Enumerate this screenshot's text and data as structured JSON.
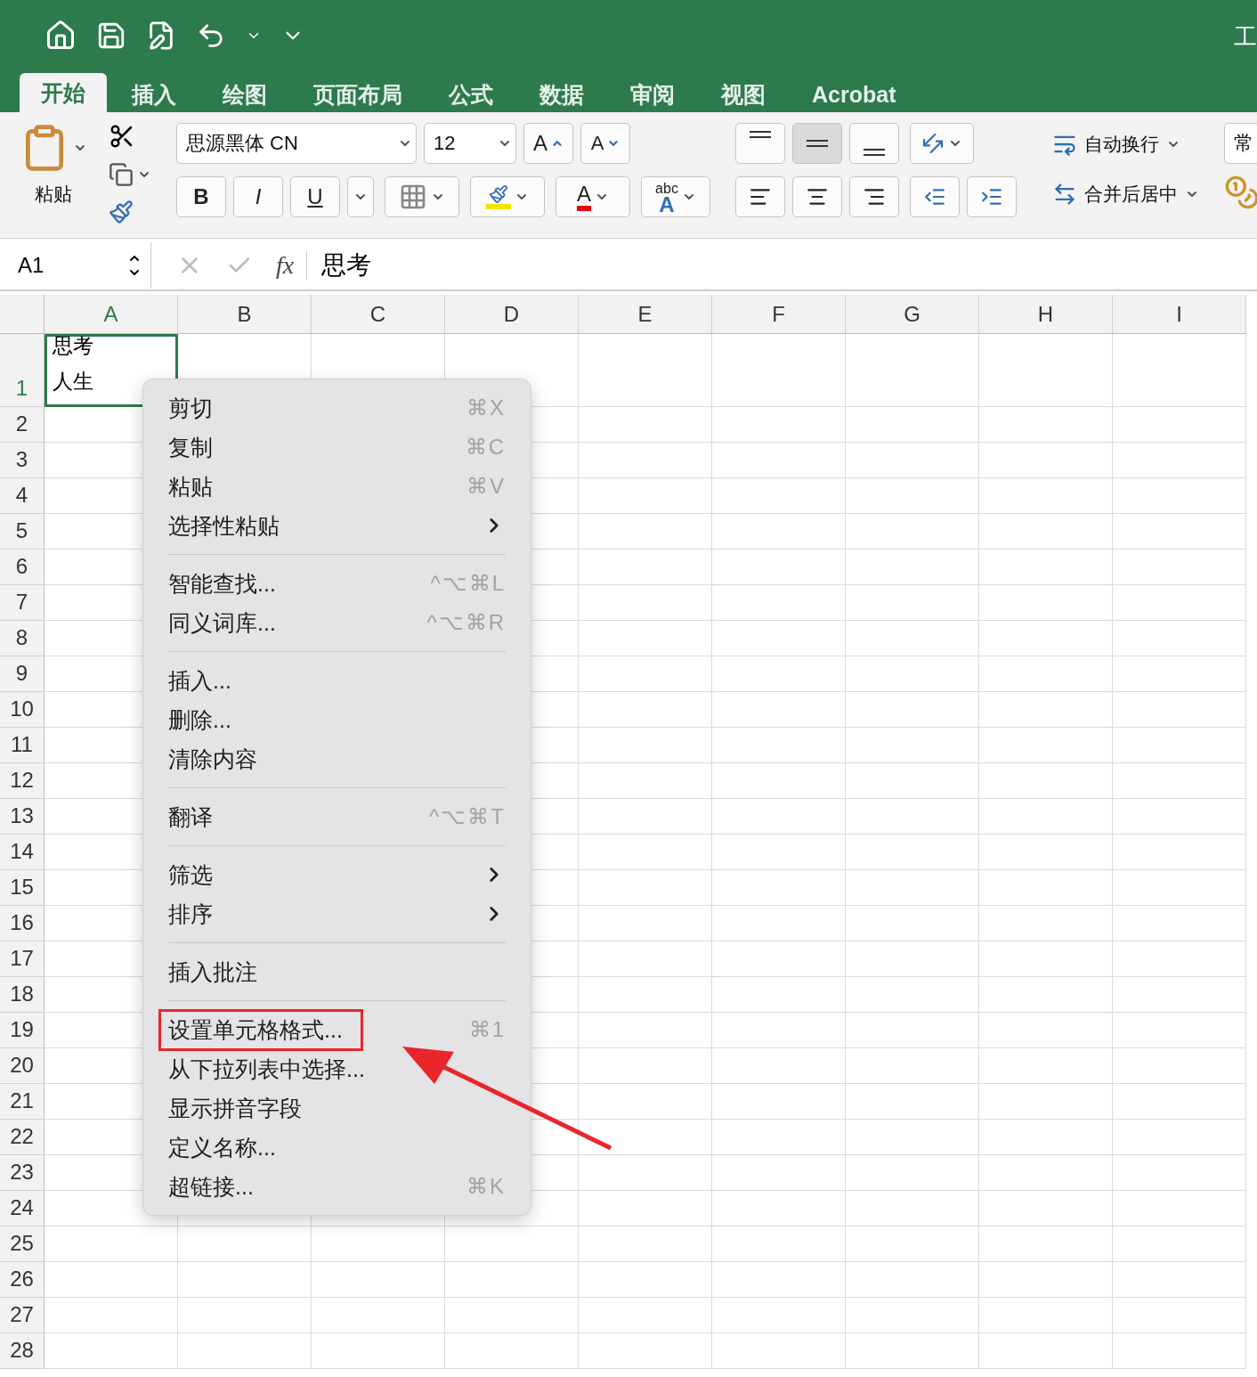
{
  "title_bar": {
    "title_fragment": "工"
  },
  "tabs": [
    {
      "label": "开始",
      "selected": true
    },
    {
      "label": "插入",
      "selected": false
    },
    {
      "label": "绘图",
      "selected": false
    },
    {
      "label": "页面布局",
      "selected": false
    },
    {
      "label": "公式",
      "selected": false
    },
    {
      "label": "数据",
      "selected": false
    },
    {
      "label": "审阅",
      "selected": false
    },
    {
      "label": "视图",
      "selected": false
    },
    {
      "label": "Acrobat",
      "selected": false
    }
  ],
  "ribbon": {
    "paste_label": "粘贴",
    "font_name": "思源黑体 CN",
    "font_size": "12",
    "grow_font": "A",
    "shrink_font": "A",
    "bold": "B",
    "italic": "I",
    "underline": "U",
    "font_color": "A",
    "phonetic_top": "abc",
    "phonetic_bottom": "A",
    "wrap_text": "自动换行",
    "merge_center": "合并后居中",
    "number_format": "常",
    "vertical_align": [
      {
        "kind": "top",
        "selected": false
      },
      {
        "kind": "middle",
        "selected": true
      },
      {
        "kind": "bottom",
        "selected": false
      }
    ]
  },
  "formula_bar": {
    "name_box": "A1",
    "fx": "fx",
    "value": "思考"
  },
  "columns": [
    "A",
    "B",
    "C",
    "D",
    "E",
    "F",
    "G",
    "H",
    "I"
  ],
  "rows": [
    "1",
    "2",
    "3",
    "4",
    "5",
    "6",
    "7",
    "8",
    "9",
    "10",
    "11",
    "12",
    "13",
    "14",
    "15",
    "16",
    "17",
    "18",
    "19",
    "20",
    "21",
    "22",
    "23",
    "24",
    "25",
    "26",
    "27",
    "28"
  ],
  "active_cell": {
    "lines": [
      "思考",
      "人生"
    ],
    "selected": true
  },
  "context_menu": {
    "groups": [
      [
        {
          "label": "剪切",
          "shortcut": "⌘X",
          "submenu": false,
          "highlighted": false
        },
        {
          "label": "复制",
          "shortcut": "⌘C",
          "submenu": false,
          "highlighted": false
        },
        {
          "label": "粘贴",
          "shortcut": "⌘V",
          "submenu": false,
          "highlighted": false
        },
        {
          "label": "选择性粘贴",
          "submenu": true,
          "highlighted": false
        }
      ],
      [
        {
          "label": "智能查找...",
          "shortcut": "^⌥⌘L",
          "submenu": false,
          "highlighted": false
        },
        {
          "label": "同义词库...",
          "shortcut": "^⌥⌘R",
          "submenu": false,
          "highlighted": false
        }
      ],
      [
        {
          "label": "插入...",
          "submenu": false,
          "highlighted": false
        },
        {
          "label": "删除...",
          "submenu": false,
          "highlighted": false
        },
        {
          "label": "清除内容",
          "submenu": false,
          "highlighted": false
        }
      ],
      [
        {
          "label": "翻译",
          "shortcut": "^⌥⌘T",
          "submenu": false,
          "highlighted": false
        }
      ],
      [
        {
          "label": "筛选",
          "submenu": true,
          "highlighted": false
        },
        {
          "label": "排序",
          "submenu": true,
          "highlighted": false
        }
      ],
      [
        {
          "label": "插入批注",
          "submenu": false,
          "highlighted": false
        }
      ],
      [
        {
          "label": "设置单元格格式...",
          "shortcut": "⌘1",
          "submenu": false,
          "highlighted": true
        },
        {
          "label": "从下拉列表中选择...",
          "submenu": false,
          "highlighted": false
        },
        {
          "label": "显示拼音字段",
          "submenu": false,
          "highlighted": false
        },
        {
          "label": "定义名称...",
          "submenu": false,
          "highlighted": false
        },
        {
          "label": "超链接...",
          "shortcut": "⌘K",
          "submenu": false,
          "highlighted": false
        }
      ]
    ]
  },
  "annotation": {
    "kind": "arrow",
    "color": "#e8262b"
  }
}
